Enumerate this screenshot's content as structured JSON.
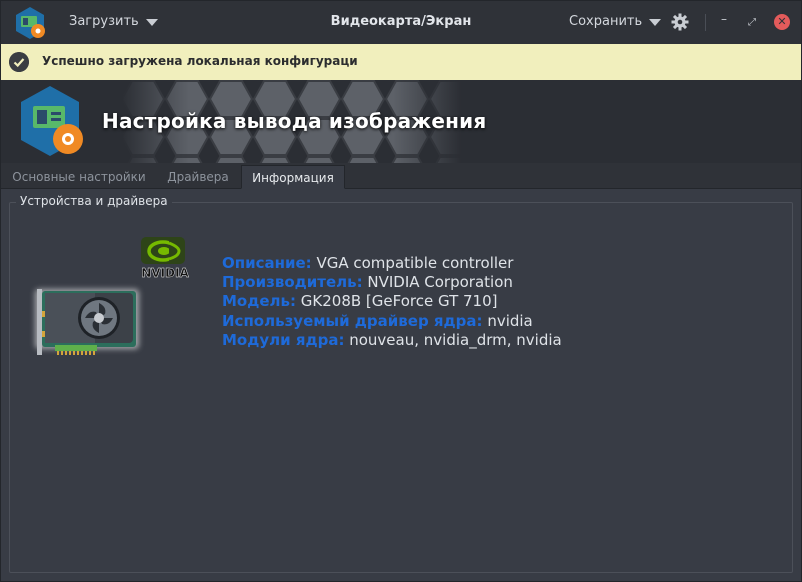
{
  "titlebar": {
    "load_label": "Загрузить",
    "title": "Видеокарта/Экран",
    "save_label": "Сохранить"
  },
  "notification": {
    "text": "Успешно загружена локальная конфигураци"
  },
  "banner": {
    "title": "Настройка вывода изображения"
  },
  "tabs": [
    {
      "label": "Основные настройки",
      "active": false
    },
    {
      "label": "Драйвера",
      "active": false
    },
    {
      "label": "Информация",
      "active": true
    }
  ],
  "group": {
    "label": "Устройства и драйвера"
  },
  "device": {
    "vendor_logo_text": "NVIDIA",
    "rows": [
      {
        "key": "Описание:",
        "value": "VGA compatible controller"
      },
      {
        "key": "Производитель:",
        "value": "NVIDIA Corporation"
      },
      {
        "key": "Модель:",
        "value": "GK208B [GeForce GT 710]"
      },
      {
        "key": "Используемый драйвер ядра:",
        "value": "nvidia"
      },
      {
        "key": "Модули ядра:",
        "value": "nouveau, nvidia_drm, nvidia"
      }
    ]
  },
  "colors": {
    "accent_key": "#1e6ad9",
    "notice_bg": "#f1efbd",
    "close_button": "#e35b5b"
  }
}
